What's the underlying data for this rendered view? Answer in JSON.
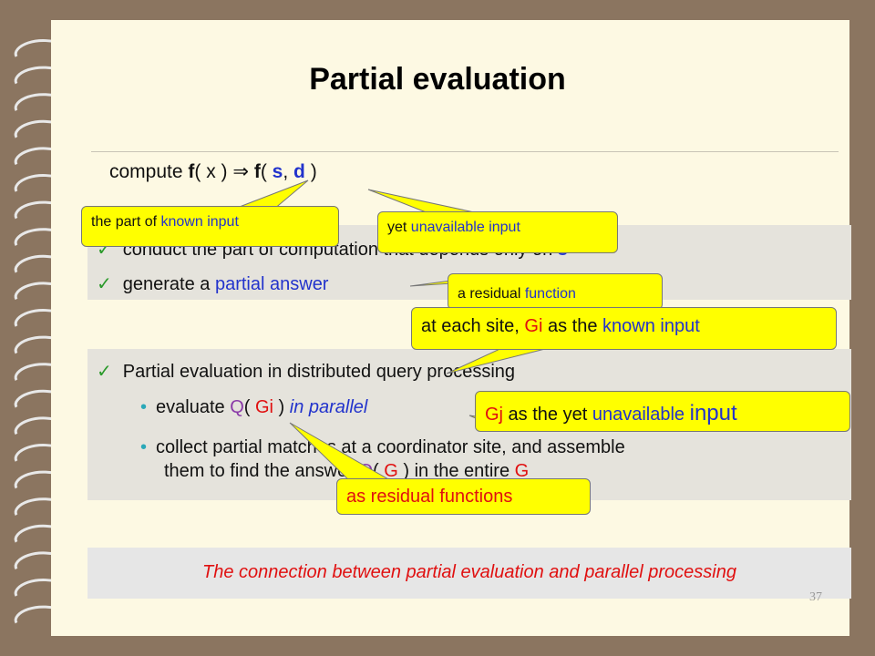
{
  "slide": {
    "title": "Partial evaluation",
    "page_number": "37"
  },
  "formula": {
    "compute": "compute",
    "f1": "f",
    "open1": "( x ) ",
    "arrow": "⇒",
    "f2": "f",
    "open2": "( ",
    "s": "s",
    "comma": ", ",
    "d": "d",
    "close": " )"
  },
  "panel1": {
    "item1_text": "conduct the part of computation that depends only on ",
    "item1_s": "s",
    "item2_prefix": "generate a ",
    "item2_highlight": "partial answer"
  },
  "panel2": {
    "heading": "Partial evaluation in distributed query processing",
    "bullet1_prefix": "evaluate ",
    "bullet1_q": "Q",
    "bullet1_open": "( ",
    "bullet1_gi": "Gi",
    "bullet1_close": " ) ",
    "bullet1_italic": "in parallel",
    "bullet2_line1": "collect partial matches at a coordinator site, and assemble",
    "bullet2_line2_prefix": "them to find the answer ",
    "bullet2_q": "Q",
    "bullet2_mid": "( ",
    "bullet2_g": "G",
    "bullet2_suffix": " ) in the entire ",
    "bullet2_g2": "G"
  },
  "conclusion": "The connection between partial evaluation and parallel processing",
  "callouts": {
    "known_input_prefix": "the part of ",
    "known_input_highlight": "known input",
    "unavailable_prefix": "yet ",
    "unavailable_highlight": "unavailable  input",
    "residual_prefix": "a residual ",
    "residual_highlight": "function",
    "each_site_prefix": "at each site, ",
    "each_site_gi": "Gi",
    "each_site_mid": " as the ",
    "each_site_highlight": "known input",
    "gj_gj": "Gj",
    "gj_mid": " as the yet ",
    "gj_highlight": "unavailable",
    "gj_big": "input",
    "residual_functions": "as residual functions"
  },
  "colors": {
    "highlight_blue": "#2233cc",
    "highlight_red": "#e01010",
    "callout_yellow": "#ffff00",
    "check_green": "#2b9a2b",
    "bullet_teal": "#2aa8b8"
  }
}
